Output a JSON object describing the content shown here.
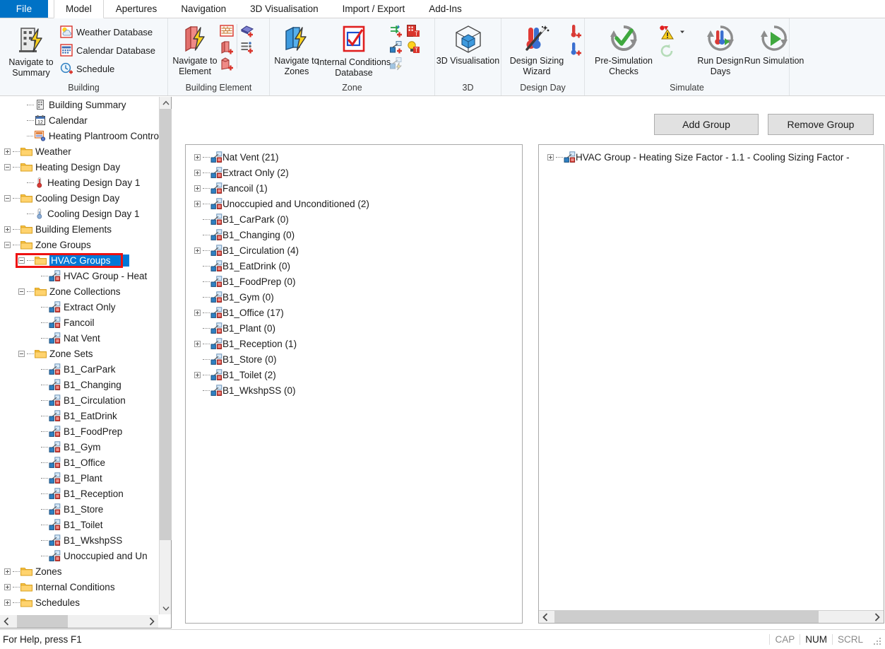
{
  "window": {
    "tabs": [
      {
        "label": "File",
        "active": false,
        "kind": "file"
      },
      {
        "label": "Model",
        "active": true
      },
      {
        "label": "Apertures",
        "active": false
      },
      {
        "label": "Navigation",
        "active": false
      },
      {
        "label": "3D Visualisation",
        "active": false
      },
      {
        "label": "Import / Export",
        "active": false
      },
      {
        "label": "Add-Ins",
        "active": false
      }
    ]
  },
  "colors": {
    "file_tab": "#0072c6",
    "selection": "#0078d7",
    "highlight_box": "#ee1111",
    "ribbon_bg": "#f5f8fb",
    "folder": "#ffc846"
  },
  "ribbon": {
    "groups": [
      {
        "title": "Building",
        "big": [
          {
            "label": "Navigate to Summary",
            "icon": "building-lightning-icon"
          }
        ],
        "small": [
          {
            "label": "Weather Database",
            "icon": "weather-database-icon"
          },
          {
            "label": "Calendar Database",
            "icon": "calendar-database-icon"
          },
          {
            "label": "Schedule",
            "icon": "schedule-icon"
          }
        ]
      },
      {
        "title": "Building Element",
        "big": [
          {
            "label": "Navigate to Element",
            "icon": "element-lightning-icon"
          }
        ],
        "icons": [
          "brick-wall-icon",
          "add-roof-icon",
          "add-wall-icon",
          "add-component-list-icon",
          "add-block-icon"
        ]
      },
      {
        "title": "Zone",
        "big": [
          {
            "label": "Navigate to Zones",
            "icon": "zone-lightning-icon"
          },
          {
            "label": "Internal Conditions Database",
            "icon": "internal-conditions-icon"
          }
        ],
        "icons": [
          "air-exchange-add-icon",
          "building-template-icon",
          "zone-group-add-icon",
          "lighting-template-icon",
          "zone-link-icon"
        ]
      },
      {
        "title": "3D",
        "big": [
          {
            "label": "3D Visualisation",
            "icon": "cube-3d-icon"
          }
        ]
      },
      {
        "title": "Design Day",
        "big": [
          {
            "label": "Design Sizing Wizard",
            "icon": "design-sizing-wand-icon"
          }
        ],
        "icons": [
          "add-heating-design-day-icon",
          "add-cooling-design-day-icon"
        ]
      },
      {
        "title": "Simulate",
        "big": [
          {
            "label": "Pre-Simulation Checks",
            "icon": "pre-simulation-checks-icon"
          },
          {
            "label": "Run Design Days",
            "icon": "run-design-days-icon"
          },
          {
            "label": "Run Simulation",
            "icon": "run-simulation-icon"
          }
        ],
        "icons": [
          "error-warning-icon",
          "refresh-icon"
        ]
      }
    ]
  },
  "tree": {
    "nodes": [
      {
        "label": "Building Summary",
        "depth": 1,
        "expander": "none",
        "icon": "building-summary-icon"
      },
      {
        "label": "Calendar",
        "depth": 1,
        "expander": "none",
        "icon": "calendar-icon"
      },
      {
        "label": "Heating Plantroom Contro",
        "depth": 1,
        "expander": "none",
        "icon": "plantroom-control-icon"
      },
      {
        "label": "Weather",
        "depth": 0,
        "expander": "plus",
        "icon": "folder-icon"
      },
      {
        "label": "Heating Design Day",
        "depth": 0,
        "expander": "minus",
        "icon": "folder-icon"
      },
      {
        "label": "Heating Design Day 1",
        "depth": 1,
        "expander": "none",
        "icon": "thermometer-red-icon"
      },
      {
        "label": "Cooling Design Day",
        "depth": 0,
        "expander": "minus",
        "icon": "folder-icon"
      },
      {
        "label": "Cooling Design Day 1",
        "depth": 1,
        "expander": "none",
        "icon": "thermometer-blue-icon"
      },
      {
        "label": "Building Elements",
        "depth": 0,
        "expander": "plus",
        "icon": "folder-icon"
      },
      {
        "label": "Zone Groups",
        "depth": 0,
        "expander": "minus",
        "icon": "folder-icon"
      },
      {
        "label": "HVAC Groups",
        "depth": 1,
        "expander": "minus",
        "icon": "folder-icon",
        "selected": true,
        "highlighted": true
      },
      {
        "label": "HVAC Group - Heat",
        "depth": 2,
        "expander": "none",
        "icon": "zone-group-icon"
      },
      {
        "label": "Zone Collections",
        "depth": 1,
        "expander": "minus",
        "icon": "folder-icon"
      },
      {
        "label": "Extract Only",
        "depth": 2,
        "expander": "none",
        "icon": "zone-group-icon"
      },
      {
        "label": "Fancoil",
        "depth": 2,
        "expander": "none",
        "icon": "zone-group-icon"
      },
      {
        "label": "Nat Vent",
        "depth": 2,
        "expander": "none",
        "icon": "zone-group-icon"
      },
      {
        "label": "Zone Sets",
        "depth": 1,
        "expander": "minus",
        "icon": "folder-icon"
      },
      {
        "label": "B1_CarPark",
        "depth": 2,
        "expander": "none",
        "icon": "zone-set-icon"
      },
      {
        "label": "B1_Changing",
        "depth": 2,
        "expander": "none",
        "icon": "zone-set-icon"
      },
      {
        "label": "B1_Circulation",
        "depth": 2,
        "expander": "none",
        "icon": "zone-set-icon"
      },
      {
        "label": "B1_EatDrink",
        "depth": 2,
        "expander": "none",
        "icon": "zone-set-icon"
      },
      {
        "label": "B1_FoodPrep",
        "depth": 2,
        "expander": "none",
        "icon": "zone-set-icon"
      },
      {
        "label": "B1_Gym",
        "depth": 2,
        "expander": "none",
        "icon": "zone-set-icon"
      },
      {
        "label": "B1_Office",
        "depth": 2,
        "expander": "none",
        "icon": "zone-set-icon"
      },
      {
        "label": "B1_Plant",
        "depth": 2,
        "expander": "none",
        "icon": "zone-set-icon"
      },
      {
        "label": "B1_Reception",
        "depth": 2,
        "expander": "none",
        "icon": "zone-set-icon"
      },
      {
        "label": "B1_Store",
        "depth": 2,
        "expander": "none",
        "icon": "zone-set-icon"
      },
      {
        "label": "B1_Toilet",
        "depth": 2,
        "expander": "none",
        "icon": "zone-set-icon"
      },
      {
        "label": "B1_WkshpSS",
        "depth": 2,
        "expander": "none",
        "icon": "zone-set-icon"
      },
      {
        "label": "Unoccupied and Un",
        "depth": 2,
        "expander": "none",
        "icon": "zone-set-icon"
      },
      {
        "label": "Zones",
        "depth": 0,
        "expander": "plus",
        "icon": "folder-icon"
      },
      {
        "label": "Internal Conditions",
        "depth": 0,
        "expander": "plus",
        "icon": "folder-icon"
      },
      {
        "label": "Schedules",
        "depth": 0,
        "expander": "plus",
        "icon": "folder-icon"
      }
    ]
  },
  "main": {
    "buttons": {
      "add_group": "Add Group",
      "remove_group": "Remove Group"
    },
    "available_list": [
      {
        "label": "Nat Vent (21)",
        "expandable": true
      },
      {
        "label": "Extract Only (2)",
        "expandable": true
      },
      {
        "label": "Fancoil (1)",
        "expandable": true
      },
      {
        "label": "Unoccupied and Unconditioned (2)",
        "expandable": true
      },
      {
        "label": "B1_CarPark (0)",
        "expandable": false
      },
      {
        "label": "B1_Changing (0)",
        "expandable": false
      },
      {
        "label": "B1_Circulation (4)",
        "expandable": true
      },
      {
        "label": "B1_EatDrink (0)",
        "expandable": false
      },
      {
        "label": "B1_FoodPrep (0)",
        "expandable": false
      },
      {
        "label": "B1_Gym (0)",
        "expandable": false
      },
      {
        "label": "B1_Office (17)",
        "expandable": true
      },
      {
        "label": "B1_Plant (0)",
        "expandable": false
      },
      {
        "label": "B1_Reception (1)",
        "expandable": true
      },
      {
        "label": "B1_Store (0)",
        "expandable": false
      },
      {
        "label": "B1_Toilet (2)",
        "expandable": true
      },
      {
        "label": "B1_WkshpSS (0)",
        "expandable": false
      }
    ],
    "group_list": [
      {
        "label": "HVAC Group - Heating Size Factor - 1.1 - Cooling Sizing Factor -",
        "expandable": true
      }
    ]
  },
  "status": {
    "hint": "For Help, press F1",
    "cells": [
      {
        "label": "CAP",
        "active": false
      },
      {
        "label": "NUM",
        "active": true
      },
      {
        "label": "SCRL",
        "active": false
      }
    ]
  }
}
